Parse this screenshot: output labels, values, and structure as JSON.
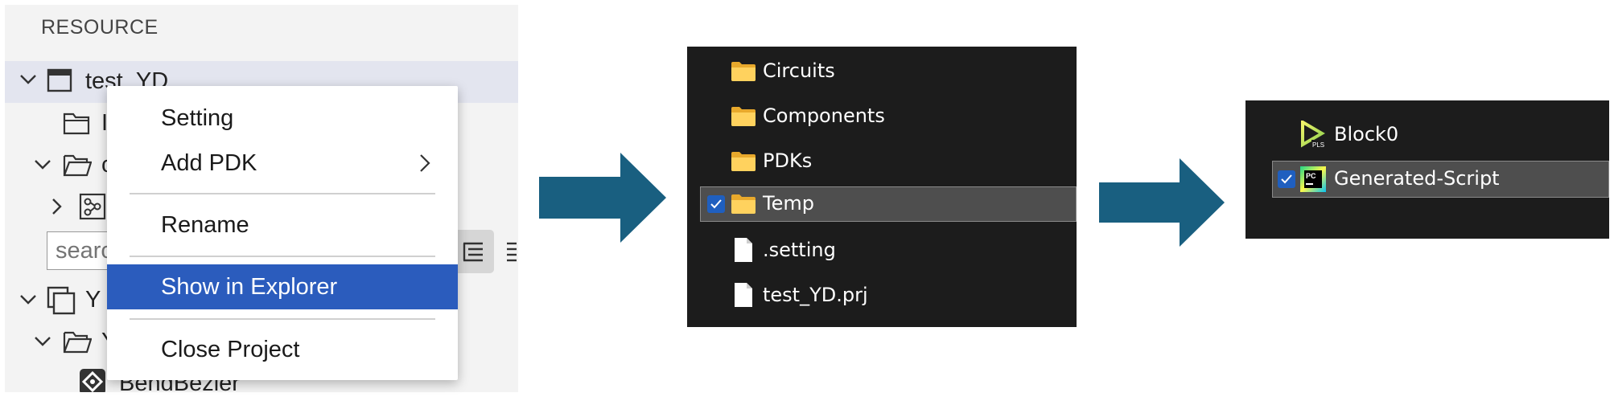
{
  "resource_panel": {
    "title": "RESOURCE",
    "tree": [
      {
        "label": "test_YD",
        "expanded": true,
        "selected": true
      },
      {
        "label": "I",
        "partial": true
      },
      {
        "label": "c",
        "partial": true
      },
      {
        "label": ""
      },
      {
        "label": "Y",
        "partial": true
      },
      {
        "label": "Y",
        "partial": true
      },
      {
        "label": "BendBezier",
        "partial": true
      }
    ],
    "search": {
      "placeholder": "search"
    }
  },
  "context_menu": {
    "items": [
      {
        "label": "Setting"
      },
      {
        "label": "Add PDK",
        "submenu": true
      },
      {
        "label": "Rename"
      },
      {
        "label": "Show in Explorer",
        "highlighted": true
      },
      {
        "label": "Close Project"
      }
    ]
  },
  "explorer": {
    "items": [
      {
        "name": "Circuits",
        "type": "folder"
      },
      {
        "name": "Components",
        "type": "folder"
      },
      {
        "name": "PDKs",
        "type": "folder"
      },
      {
        "name": "Temp",
        "type": "folder",
        "selected": true,
        "checked": true
      },
      {
        "name": ".setting",
        "type": "file"
      },
      {
        "name": "test_YD.prj",
        "type": "file"
      }
    ]
  },
  "block_list": {
    "items": [
      {
        "name": "Block0",
        "icon": "pls-play-icon"
      },
      {
        "name": "Generated-Script",
        "icon": "pycharm-icon",
        "selected": true,
        "checked": true
      }
    ],
    "pls_icon_text": "PLS",
    "pc_icon_text": "PC"
  },
  "colors": {
    "arrow": "#195f80",
    "menu_highlight": "#2b5cbd",
    "dark_bg": "#1c1c1c",
    "folder": "#f5c24a",
    "checkbox": "#1f5fbf"
  }
}
